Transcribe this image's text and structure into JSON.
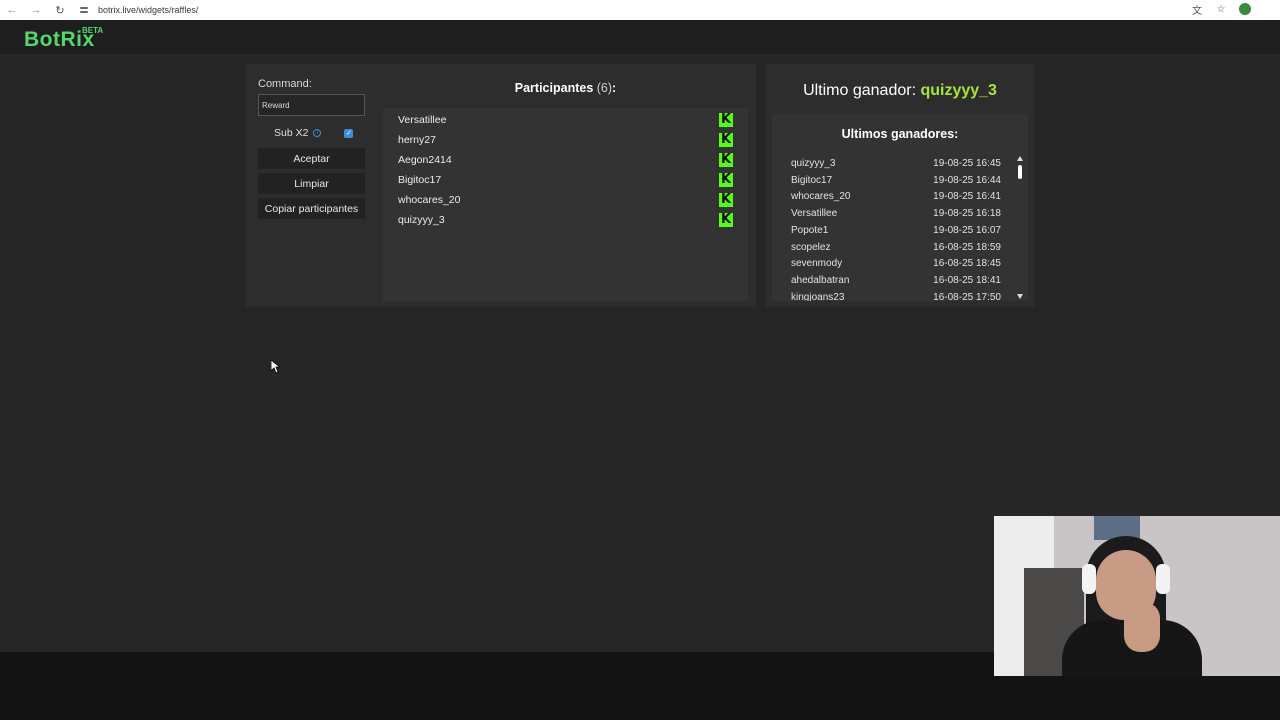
{
  "browser": {
    "back_icon": "←",
    "forward_icon": "→",
    "reload_icon": "↻",
    "url": "botrix.live/widgets/raffles/",
    "translate_icon": "文",
    "star_icon": "☆"
  },
  "app": {
    "logo": "BotRix",
    "logo_badge": "BETA"
  },
  "controls": {
    "command_label": "Command:",
    "command_value": "Reward",
    "sub_label": "Sub X2",
    "info_icon": "i",
    "sub_checked": true,
    "check_mark": "✓",
    "accept_button": "Aceptar",
    "clear_button": "Limpiar",
    "copy_button": "Copiar participantes"
  },
  "participants": {
    "title": "Participantes",
    "count": "(6)",
    "colon": ":",
    "platform_icon_text": "K",
    "items": [
      "Versatillee",
      "herny27",
      "Aegon2414",
      "Bigitoc17",
      "whocares_20",
      "quizyyy_3"
    ]
  },
  "winner": {
    "label": "Ultimo ganador: ",
    "name": "quizyyy_3"
  },
  "winners_list": {
    "title": "Ultimos ganadores:",
    "rows": [
      {
        "name": "quizyyy_3",
        "time": "19-08-25 16:45"
      },
      {
        "name": "Bigitoc17",
        "time": "19-08-25 16:44"
      },
      {
        "name": "whocares_20",
        "time": "19-08-25 16:41"
      },
      {
        "name": "Versatillee",
        "time": "19-08-25 16:18"
      },
      {
        "name": "Popote1",
        "time": "19-08-25 16:07"
      },
      {
        "name": "scopelez",
        "time": "16-08-25 18:59"
      },
      {
        "name": "sevenmody",
        "time": "16-08-25 18:45"
      },
      {
        "name": "ahedalbatran",
        "time": "16-08-25 18:41"
      },
      {
        "name": "kingjoans23",
        "time": "16-08-25 17:50"
      }
    ]
  },
  "colors": {
    "brand_green": "#53d86a",
    "kick_green": "#53fc18",
    "winner_green": "#a3e635",
    "checkbox_blue": "#3c8de0"
  }
}
